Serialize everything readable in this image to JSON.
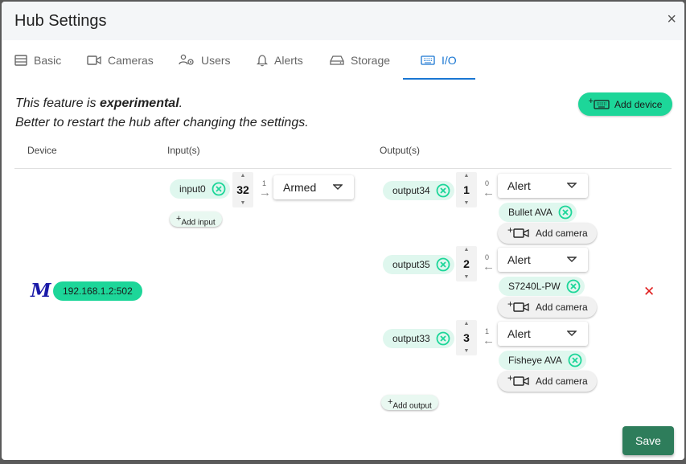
{
  "dialog": {
    "title": "Hub Settings",
    "close_glyph": "×"
  },
  "tabs": [
    {
      "label": "Basic",
      "icon": "list-icon"
    },
    {
      "label": "Cameras",
      "icon": "video-camera-icon"
    },
    {
      "label": "Users",
      "icon": "users-gear-icon"
    },
    {
      "label": "Alerts",
      "icon": "bell-icon"
    },
    {
      "label": "Storage",
      "icon": "hard-drive-icon"
    },
    {
      "label": "I/O",
      "icon": "keyboard-icon",
      "active": true
    }
  ],
  "notice": {
    "prefix": "This feature is ",
    "emphasis": "experimental",
    "suffix": ".",
    "line2": "Better to restart the hub after changing the settings."
  },
  "add_device": {
    "plus": "+",
    "label": "Add device"
  },
  "columns": {
    "device": "Device",
    "inputs": "Input(s)",
    "outputs": "Output(s)"
  },
  "device": {
    "logo": "M",
    "address": "192.168.1.2:502",
    "inputs": [
      {
        "name": "input0",
        "number": "32",
        "small": "1",
        "mode": "Armed"
      }
    ],
    "add_input": {
      "plus": "+",
      "label": "Add input"
    },
    "outputs": [
      {
        "name": "output34",
        "number": "1",
        "small": "0",
        "mode": "Alert",
        "camera": "Bullet AVA"
      },
      {
        "name": "output35",
        "number": "2",
        "small": "0",
        "mode": "Alert",
        "camera": "S7240L-PW"
      },
      {
        "name": "output33",
        "number": "3",
        "small": "1",
        "mode": "Alert",
        "camera": "Fisheye AVA"
      }
    ],
    "add_camera": {
      "plus": "+",
      "label": "Add camera"
    },
    "add_output": {
      "plus": "+",
      "label": "Add output"
    },
    "delete_glyph": "✕"
  },
  "save_label": "Save",
  "colors": {
    "accent": "#1dd699",
    "chip_bg": "#dff7ee",
    "tab_active": "#1976d2",
    "save": "#2e7d5b",
    "delete": "#e02020"
  }
}
